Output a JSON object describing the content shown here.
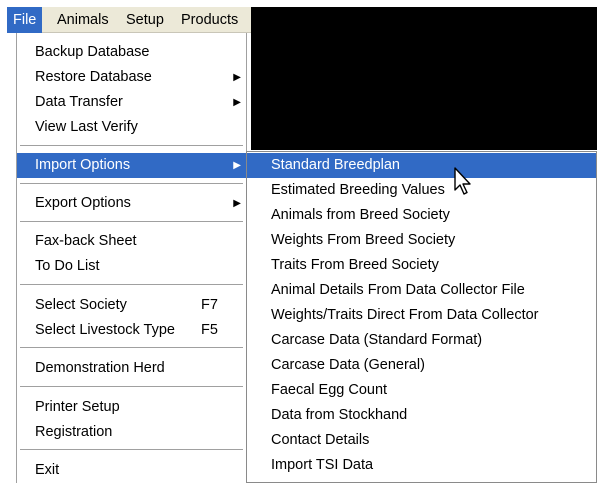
{
  "menubar": {
    "items": [
      "File",
      "Animals",
      "Setup",
      "Products"
    ]
  },
  "file_menu": {
    "backup_database": "Backup Database",
    "restore_database": "Restore Database",
    "data_transfer": "Data Transfer",
    "view_last_verify": "View Last Verify",
    "import_options": "Import Options",
    "export_options": "Export Options",
    "fax_back_sheet": "Fax-back Sheet",
    "to_do_list": "To Do List",
    "select_society": "Select Society",
    "select_society_shortcut": "F7",
    "select_livestock_type": "Select Livestock Type",
    "select_livestock_type_shortcut": "F5",
    "demonstration_herd": "Demonstration Herd",
    "printer_setup": "Printer Setup",
    "registration": "Registration",
    "exit": "Exit"
  },
  "import_submenu": {
    "items": [
      "Standard Breedplan",
      "Estimated Breeding Values",
      "Animals from Breed Society",
      "Weights From Breed Society",
      "Traits From Breed Society",
      "Animal Details From Data Collector File",
      "Weights/Traits Direct From Data Collector",
      "Carcase Data (Standard Format)",
      "Carcase Data (General)",
      "Faecal Egg Count",
      "Data from Stockhand",
      "Contact Details",
      "Import TSI Data"
    ],
    "highlighted": "Standard Breedplan"
  },
  "icons": {
    "submenu_arrow": "submenu-arrow-icon",
    "cursor": "mouse-pointer-icon"
  },
  "colors": {
    "highlight": "#316ac5",
    "menubar_bg": "#ece9d8",
    "background_window": "#000000"
  }
}
